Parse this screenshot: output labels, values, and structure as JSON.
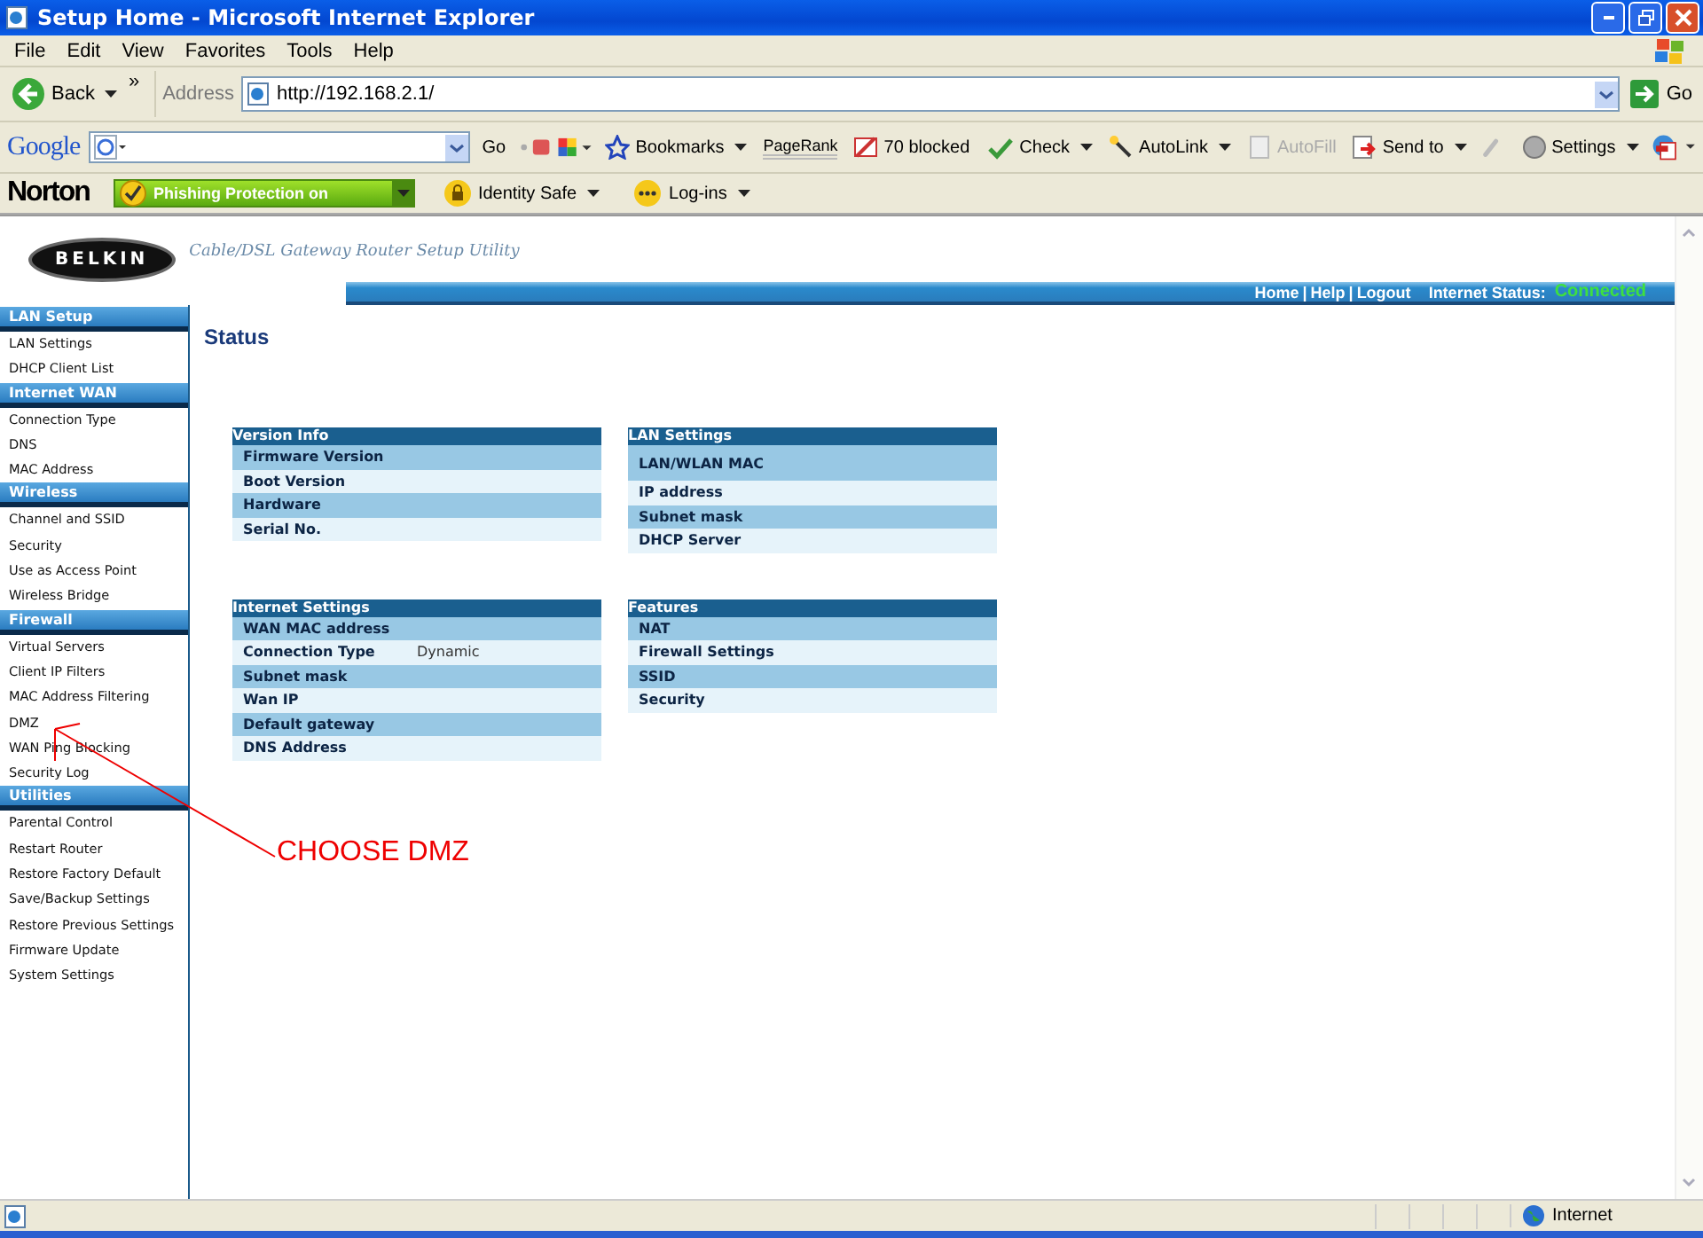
{
  "window": {
    "title": "Setup Home - Microsoft Internet Explorer"
  },
  "menu": [
    "File",
    "Edit",
    "View",
    "Favorites",
    "Tools",
    "Help"
  ],
  "nav": {
    "back": "Back",
    "chevron": "»",
    "address_label": "Address",
    "url": "http://192.168.2.1/",
    "go": "Go"
  },
  "google_toolbar": {
    "brand": "Google",
    "go": "Go",
    "items": [
      {
        "kind": "star",
        "label": "Bookmarks",
        "dropdown": true,
        "disabled": false
      },
      {
        "kind": "pagerank",
        "label": "PageRank",
        "dropdown": false,
        "disabled": false
      },
      {
        "kind": "blocked",
        "label": "70 blocked",
        "dropdown": false,
        "disabled": false
      },
      {
        "kind": "check",
        "label": "Check",
        "dropdown": true,
        "disabled": false
      },
      {
        "kind": "wand",
        "label": "AutoLink",
        "dropdown": true,
        "disabled": false
      },
      {
        "kind": "form",
        "label": "AutoFill",
        "dropdown": false,
        "disabled": true
      },
      {
        "kind": "send",
        "label": "Send to",
        "dropdown": true,
        "disabled": false
      }
    ],
    "settings": "Settings"
  },
  "norton_toolbar": {
    "brand": "Norton",
    "phishing": "Phishing Protection on",
    "items": [
      {
        "kind": "lock",
        "label": "Identity Safe"
      },
      {
        "kind": "dots",
        "label": "Log-ins"
      }
    ]
  },
  "page_header": {
    "brand": "BELKIN",
    "subtitle": "Cable/DSL Gateway Router Setup Utility",
    "links": [
      "Home",
      "Help",
      "Logout"
    ],
    "separator": "|",
    "status_label": "Internet Status:",
    "status_value": "Connected"
  },
  "sidebar": [
    {
      "title": "LAN Setup",
      "items": [
        "LAN Settings",
        "DHCP Client List"
      ]
    },
    {
      "title": "Internet WAN",
      "items": [
        "Connection Type",
        "DNS",
        "MAC Address"
      ]
    },
    {
      "title": "Wireless",
      "items": [
        "Channel and SSID",
        "Security",
        "Use as Access Point",
        "Wireless Bridge"
      ]
    },
    {
      "title": "Firewall",
      "items": [
        "Virtual Servers",
        "Client IP Filters",
        "MAC Address Filtering",
        "DMZ",
        "WAN Ping Blocking",
        "Security Log"
      ]
    },
    {
      "title": "Utilities",
      "items": [
        "Parental Control",
        "Restart Router",
        "Restore Factory Default",
        "Save/Backup Settings",
        "Restore Previous Settings",
        "Firmware Update",
        "System Settings"
      ]
    }
  ],
  "page_title": "Status",
  "panels": [
    {
      "title": "Version Info",
      "rows": [
        {
          "label": "Firmware Version",
          "tall": false
        },
        {
          "label": "Boot Version",
          "tall": false
        },
        {
          "label": "Hardware",
          "tall": false
        },
        {
          "label": "Serial No.",
          "tall": false
        }
      ]
    },
    {
      "title": "LAN Settings",
      "rows": [
        {
          "label": "LAN/WLAN MAC",
          "tall": true
        },
        {
          "label": "IP address",
          "tall": false
        },
        {
          "label": "Subnet mask",
          "tall": false
        },
        {
          "label": "DHCP Server",
          "tall": false
        }
      ]
    },
    {
      "title": "Internet Settings",
      "rows": [
        {
          "label": "WAN MAC address",
          "tall": false
        },
        {
          "label": "Connection Type",
          "value": "Dynamic",
          "tall": false
        },
        {
          "label": "Subnet mask",
          "tall": false
        },
        {
          "label": "Wan IP",
          "tall": false
        },
        {
          "label": "Default gateway",
          "tall": false
        },
        {
          "label": "DNS Address",
          "tall": false
        }
      ]
    },
    {
      "title": "Features",
      "rows": [
        {
          "label": "NAT",
          "tall": false
        },
        {
          "label": "Firewall Settings",
          "tall": false
        },
        {
          "label": "SSID",
          "tall": false
        },
        {
          "label": "Security",
          "tall": false
        }
      ]
    }
  ],
  "annotation": "CHOOSE DMZ",
  "status_bar": {
    "zone": "Internet"
  }
}
